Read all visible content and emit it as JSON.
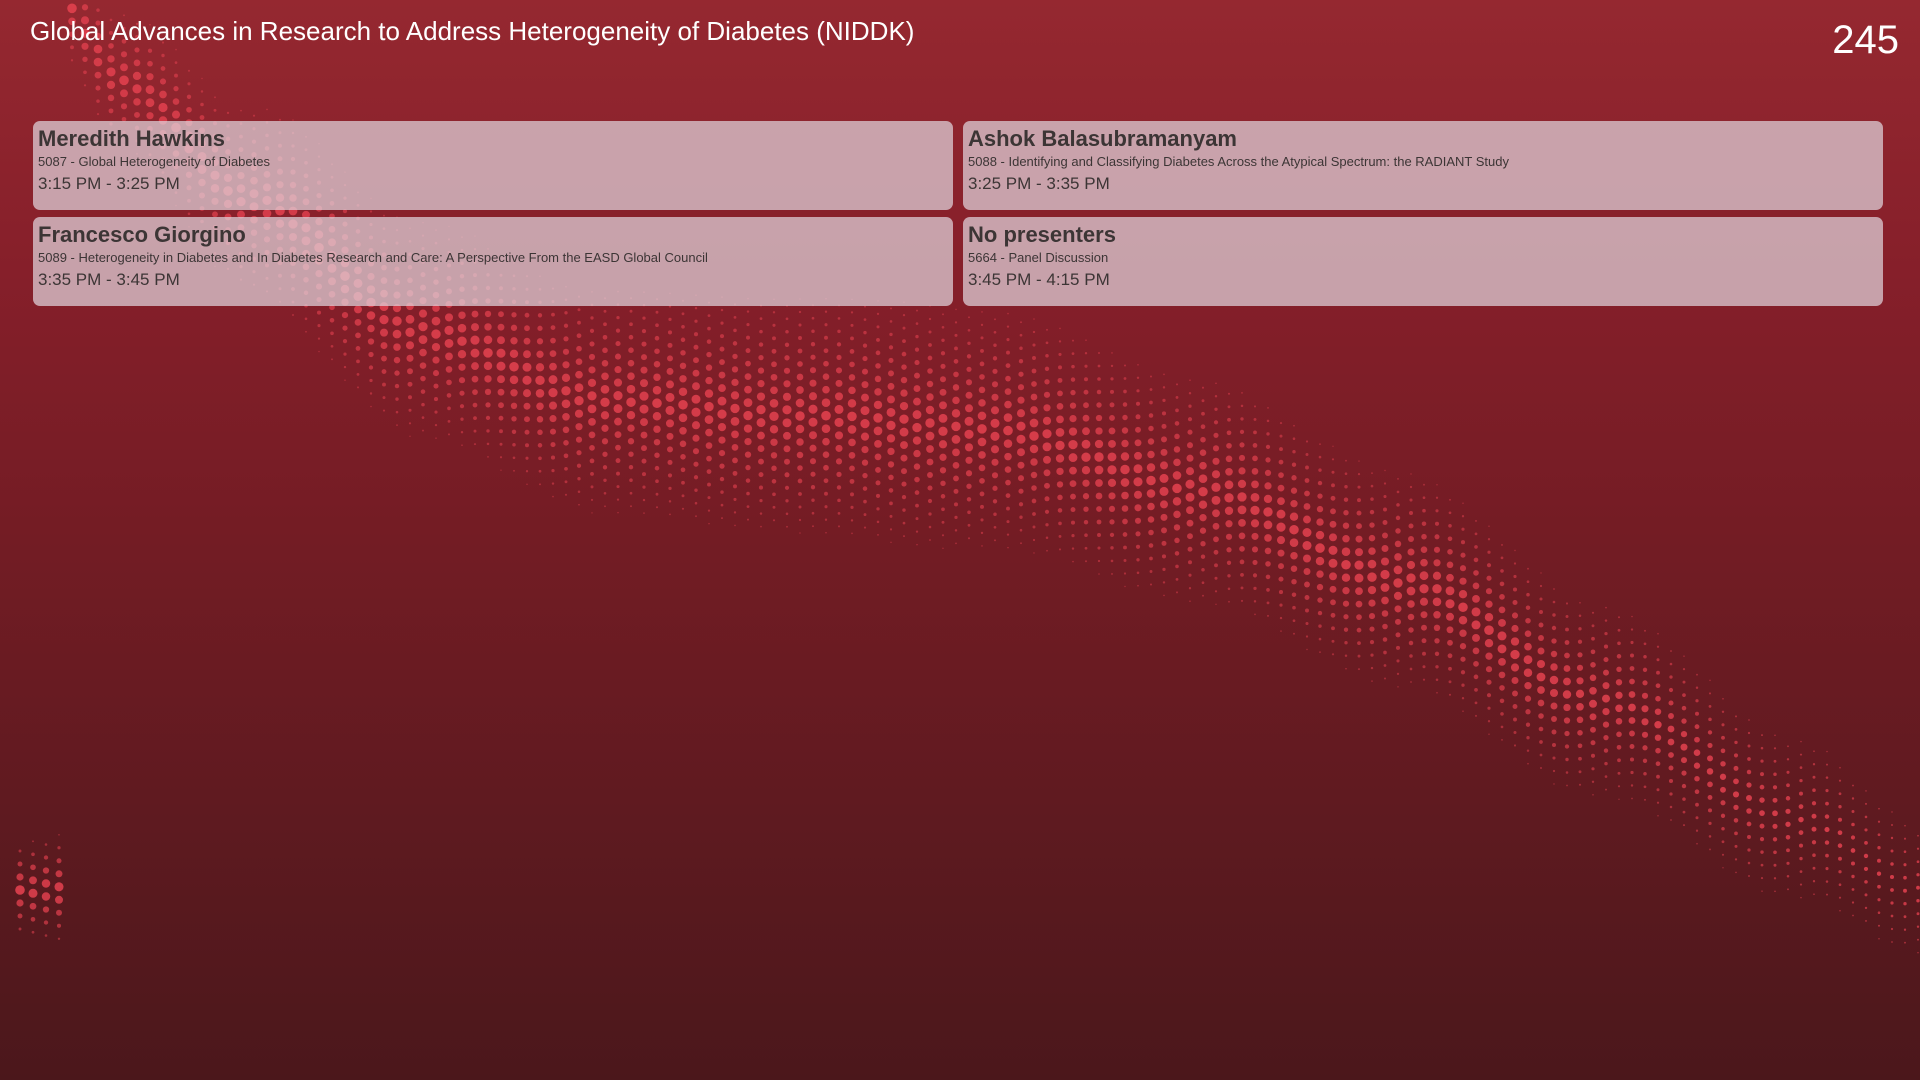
{
  "header": {
    "title": "Global Advances in Research to Address Heterogeneity of Diabetes (NIDDK)",
    "room": "245"
  },
  "sessions": [
    {
      "presenter": "Meredith Hawkins",
      "session": "5087 - Global Heterogeneity of Diabetes",
      "time": "3:15 PM - 3:25 PM"
    },
    {
      "presenter": "Ashok Balasubramanyam",
      "session": "5088 - Identifying and Classifying Diabetes Across the Atypical Spectrum: the RADIANT Study",
      "time": "3:25 PM - 3:35 PM"
    },
    {
      "presenter": "Francesco Giorgino",
      "session": "5089 - Heterogeneity in Diabetes and In Diabetes Research and Care: A Perspective From the EASD Global Council",
      "time": "3:35 PM - 3:45 PM"
    },
    {
      "presenter": "No presenters",
      "session": "5664 - Panel Discussion",
      "time": "3:45 PM - 4:15 PM"
    }
  ],
  "colors": {
    "background_top": "#952830",
    "background_bottom": "#4b171b",
    "dot_color": "#e0404e",
    "card_background": "#e1d4dc",
    "card_text": "#3c3535"
  }
}
